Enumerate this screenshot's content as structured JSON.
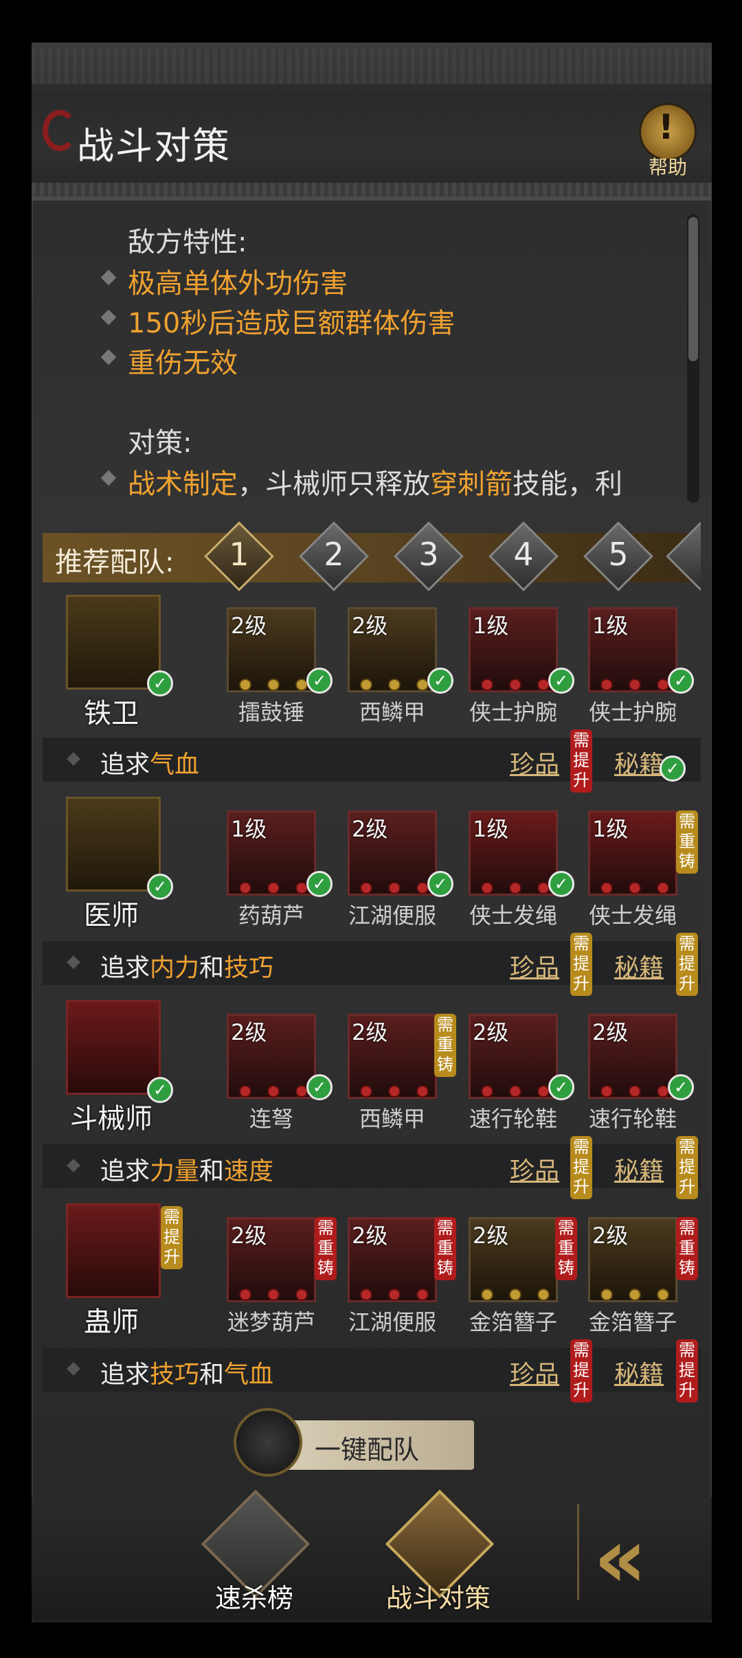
{
  "header": {
    "title": "战斗对策",
    "help_label": "帮助",
    "help_mark": "!"
  },
  "enemy": {
    "heading": "敌方特性:",
    "traits": [
      "极高单体外功伤害",
      "150秒后造成巨额群体伤害",
      "重伤无效"
    ]
  },
  "strategy": {
    "heading": "对策:",
    "line1_a": "战术制定",
    "line1_b": "，斗械师只释放",
    "line1_c": "穿刺箭",
    "line1_d": "技能，利"
  },
  "recommend": {
    "label": "推荐配队:",
    "numbers": [
      "1",
      "2",
      "3",
      "4",
      "5"
    ]
  },
  "roles": [
    {
      "name": "铁卫",
      "pursue_a": "追求",
      "pursue_h1": "气血",
      "pursue_and": "",
      "pursue_h2": "",
      "treasure": "珍品",
      "secret": "秘籍",
      "items": [
        {
          "level": "2级",
          "name": "擂鼓锤"
        },
        {
          "level": "2级",
          "name": "西鳞甲"
        },
        {
          "level": "1级",
          "name": "侠士护腕"
        },
        {
          "level": "1级",
          "name": "侠士护腕"
        }
      ]
    },
    {
      "name": "医师",
      "pursue_a": "追求",
      "pursue_h1": "内力",
      "pursue_and": "和",
      "pursue_h2": "技巧",
      "treasure": "珍品",
      "secret": "秘籍",
      "items": [
        {
          "level": "1级",
          "name": "药葫芦"
        },
        {
          "level": "2级",
          "name": "江湖便服"
        },
        {
          "level": "1级",
          "name": "侠士发绳"
        },
        {
          "level": "1级",
          "name": "侠士发绳"
        }
      ]
    },
    {
      "name": "斗械师",
      "pursue_a": "追求",
      "pursue_h1": "力量",
      "pursue_and": "和",
      "pursue_h2": "速度",
      "treasure": "珍品",
      "secret": "秘籍",
      "items": [
        {
          "level": "2级",
          "name": "连弩"
        },
        {
          "level": "2级",
          "name": "西鳞甲"
        },
        {
          "level": "2级",
          "name": "速行轮鞋"
        },
        {
          "level": "2级",
          "name": "速行轮鞋"
        }
      ]
    },
    {
      "name": "蛊师",
      "pursue_a": "追求",
      "pursue_h1": "技巧",
      "pursue_and": "和",
      "pursue_h2": "气血",
      "treasure": "珍品",
      "secret": "秘籍",
      "items": [
        {
          "level": "2级",
          "name": "迷梦葫芦"
        },
        {
          "level": "2级",
          "name": "江湖便服"
        },
        {
          "level": "2级",
          "name": "金箔簪子"
        },
        {
          "level": "2级",
          "name": "金箔簪子"
        }
      ]
    }
  ],
  "badges": {
    "upgrade": "需提升",
    "recast": "需重铸"
  },
  "one_key": "一键配队",
  "tabs": {
    "speed_rank": "速杀榜",
    "battle_strategy": "战斗对策"
  },
  "colors": {
    "highlight": "#f0a230",
    "check": "#2f9e3f",
    "badge_red": "#b01c1c",
    "badge_gold": "#b88b1d"
  }
}
